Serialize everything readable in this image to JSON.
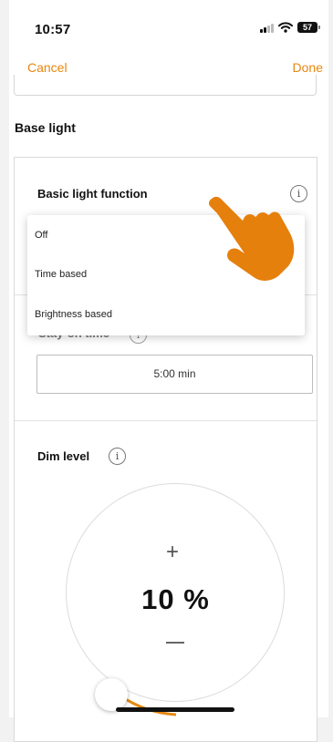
{
  "status_bar": {
    "time": "10:57",
    "battery": "57"
  },
  "nav": {
    "cancel": "Cancel",
    "done": "Done"
  },
  "section": {
    "title": "Base light"
  },
  "basic_light_function": {
    "label": "Basic light function",
    "options": [
      "Off",
      "Time based",
      "Brightness based"
    ]
  },
  "stay_on": {
    "label": "Stay-on time",
    "value": "5:00 min"
  },
  "dim_level": {
    "label": "Dim level",
    "value": "10 %",
    "plus": "+"
  },
  "info_glyph": "i",
  "colors": {
    "accent": "#e8870f",
    "hand": "#e5800d"
  },
  "icons": [
    "signal-icon",
    "wifi-icon",
    "battery-icon",
    "info-icon",
    "hand-pointer-icon"
  ]
}
